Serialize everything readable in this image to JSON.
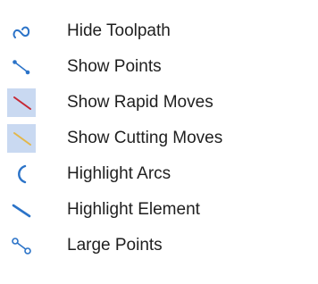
{
  "menu": {
    "items": [
      {
        "label": "Hide Toolpath",
        "icon": "toolpath-curve-icon",
        "checked": false
      },
      {
        "label": "Show Points",
        "icon": "points-icon",
        "checked": false
      },
      {
        "label": "Show Rapid Moves",
        "icon": "rapid-move-line-icon",
        "checked": true
      },
      {
        "label": "Show Cutting Moves",
        "icon": "cutting-move-line-icon",
        "checked": true
      },
      {
        "label": "Highlight Arcs",
        "icon": "arc-icon",
        "checked": false
      },
      {
        "label": "Highlight Element",
        "icon": "element-line-icon",
        "checked": false
      },
      {
        "label": "Large Points",
        "icon": "large-points-icon",
        "checked": false
      }
    ]
  },
  "colors": {
    "icon_blue": "#2b73c8",
    "rapid_red": "#c62834",
    "cutting_yellow": "#e3b74a",
    "checked_bg": "#c9d9f1"
  }
}
